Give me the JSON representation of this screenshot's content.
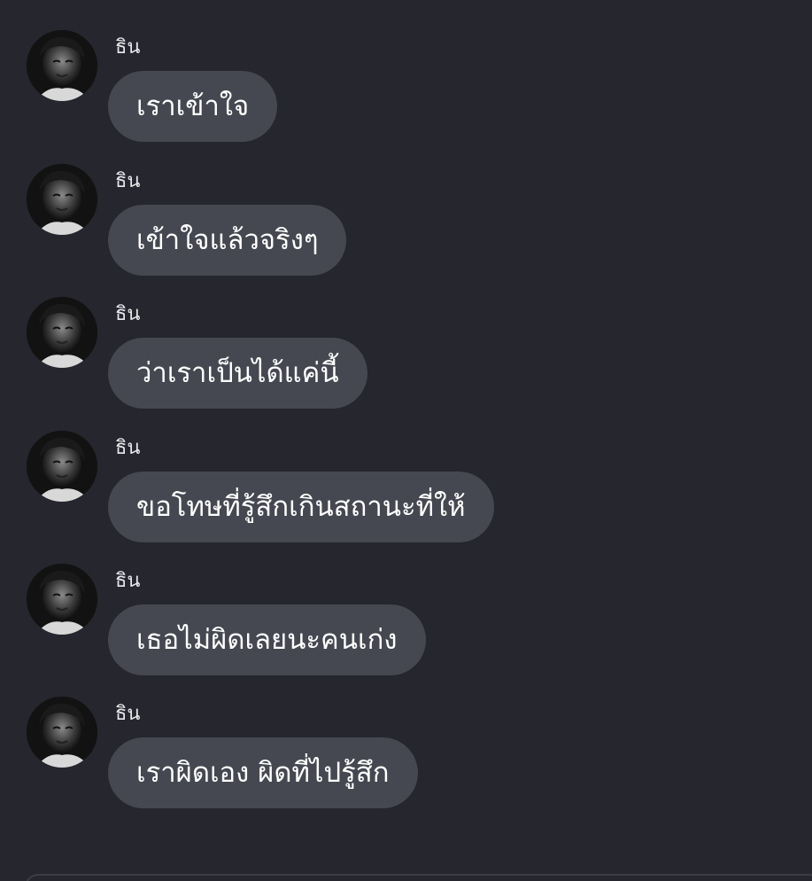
{
  "messages": [
    {
      "sender": "ธิน",
      "text": "เราเข้าใจ"
    },
    {
      "sender": "ธิน",
      "text": "เข้าใจแล้วจริงๆ"
    },
    {
      "sender": "ธิน",
      "text": "ว่าเราเป็นได้แค่นี้"
    },
    {
      "sender": "ธิน",
      "text": "ขอโทษที่รู้สึกเกินสถานะที่ให้"
    },
    {
      "sender": "ธิน",
      "text": "เธอไม่ผิดเลยนะคนเก่ง"
    },
    {
      "sender": "ธิน",
      "text": "เราผิดเอง ผิดที่ไปรู้สึก"
    }
  ],
  "avatar": {
    "icon": "profile-photo",
    "tone": "grayscale"
  },
  "colors": {
    "background": "#25262e",
    "bubble": "#464851",
    "text": "#ffffff",
    "sender": "#e8e8ea"
  }
}
